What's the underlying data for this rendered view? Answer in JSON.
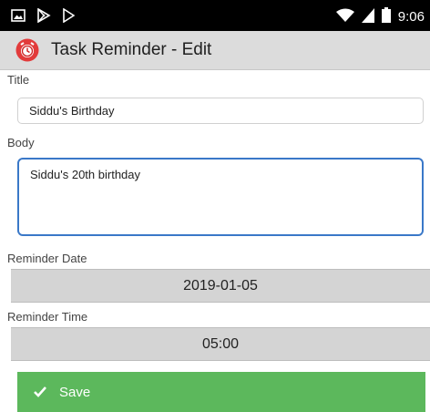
{
  "status_bar": {
    "time": "9:06",
    "left_icons": [
      "image-icon",
      "play-store-icon",
      "play-icon"
    ],
    "right_icons": [
      "wifi-icon",
      "signal-icon",
      "battery-icon"
    ]
  },
  "app_bar": {
    "title": "Task Reminder - Edit",
    "icon": "alarm-clock-icon",
    "background": "#dcdcdc"
  },
  "form": {
    "title_label": "Title",
    "title_value": "Siddu's Birthday",
    "body_label": "Body",
    "body_value": "Siddu's 20th birthday",
    "reminder_date_label": "Reminder Date",
    "reminder_date_value": "2019-01-05",
    "reminder_time_label": "Reminder Time",
    "reminder_time_value": "05:00",
    "save_label": "Save",
    "accent_color": "#3a78c8",
    "save_color": "#5cb85c"
  }
}
